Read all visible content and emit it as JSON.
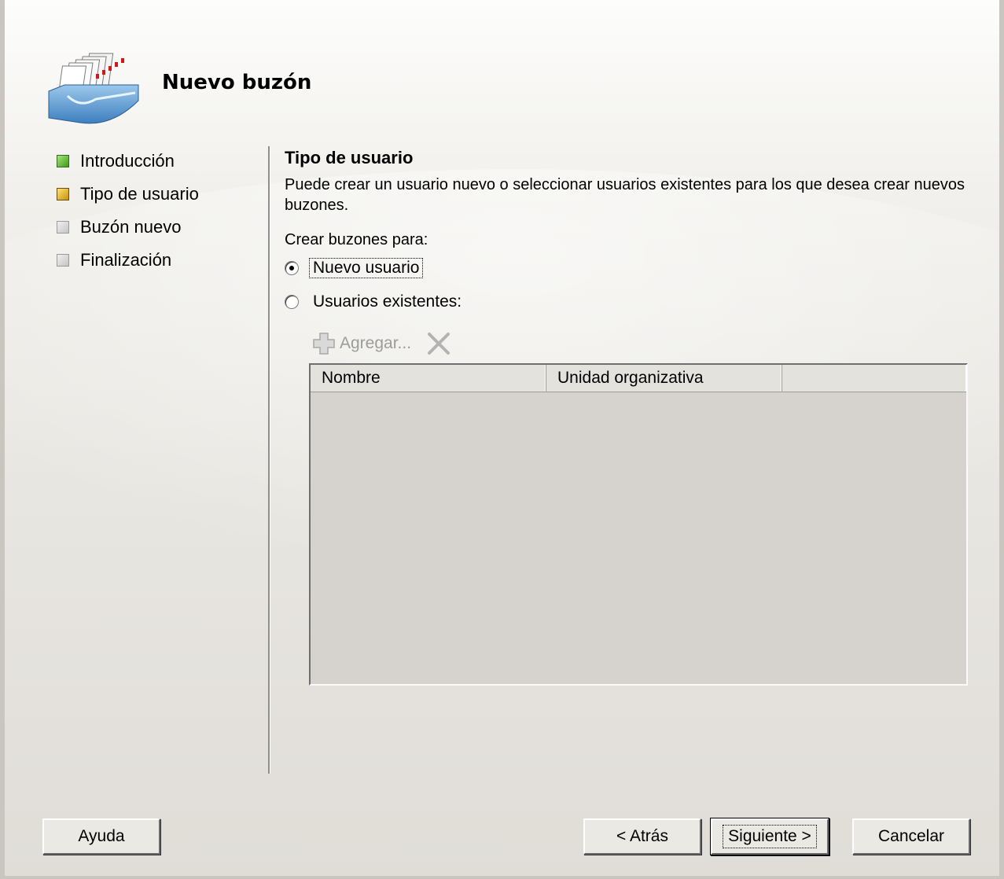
{
  "wizard": {
    "title": "Nuevo buzón",
    "steps": [
      {
        "label": "Introducción",
        "state": "done"
      },
      {
        "label": "Tipo de usuario",
        "state": "current"
      },
      {
        "label": "Buzón nuevo",
        "state": "pending"
      },
      {
        "label": "Finalización",
        "state": "pending"
      }
    ]
  },
  "page": {
    "section_title": "Tipo de usuario",
    "description": "Puede crear un usuario nuevo o seleccionar usuarios existentes para los que desea crear nuevos buzones.",
    "create_for_label": "Crear buzones para:",
    "radio_options": [
      {
        "label": "Nuevo usuario",
        "checked": true
      },
      {
        "label": "Usuarios existentes:",
        "checked": false
      }
    ],
    "toolbar": {
      "add_label": "Agregar...",
      "add_icon": "plus-icon",
      "remove_icon": "close-x-icon"
    },
    "list": {
      "columns": [
        "Nombre",
        "Unidad organizativa",
        ""
      ],
      "rows": []
    }
  },
  "buttons": {
    "help": "Ayuda",
    "back": "< Atrás",
    "next": "Siguiente >",
    "cancel": "Cancelar"
  },
  "colors": {
    "step_done": "#3d9a1c",
    "step_current": "#c99208",
    "step_pending": "#c4c4c4",
    "list_background": "#d6d3ce"
  }
}
